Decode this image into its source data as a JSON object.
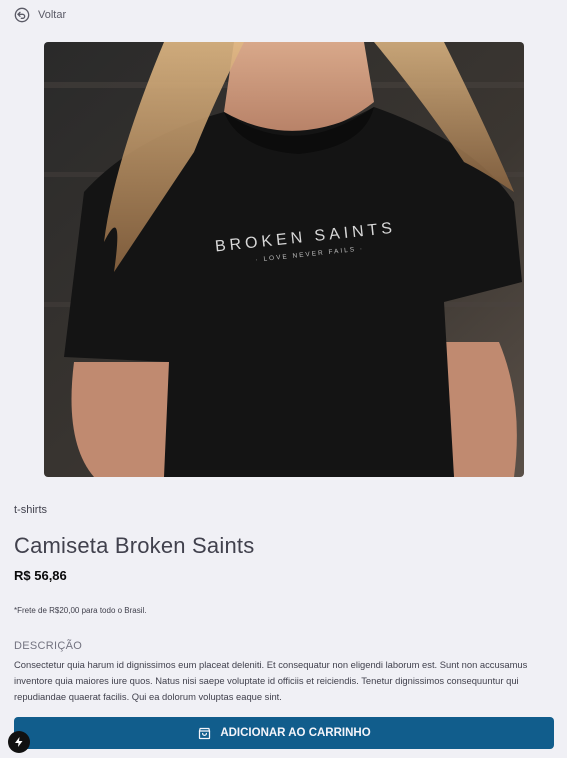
{
  "nav": {
    "back_label": "Voltar",
    "back_icon": "return-arrow-icon"
  },
  "product": {
    "image_alt": "woman wearing black Broken Saints t-shirt",
    "shirt_print_title": "BROKEN SAINTS",
    "shirt_print_subtitle": "· LOVE NEVER FAILS ·",
    "category": "t-shirts",
    "name": "Camiseta Broken Saints",
    "price": "R$ 56,86",
    "shipping_note": "*Frete de R$20,00 para todo o Brasil."
  },
  "description": {
    "title": "DESCRIÇÃO",
    "text": "Consectetur quia harum id dignissimos eum placeat deleniti. Et consequatur non eligendi laborum est. Sunt non accusamus inventore quia maiores iure quos. Natus nisi saepe voluptate id officiis et reiciendis. Tenetur dignissimos consequuntur qui repudiandae quaerat facilis. Qui ea dolorum voluptas eaque sint."
  },
  "cart_button": {
    "label": "ADICIONAR AO CARRINHO",
    "icon": "shopping-bag-icon"
  },
  "colors": {
    "background": "#f0f0f5",
    "accent": "#115d8c",
    "text": "#41414d"
  }
}
